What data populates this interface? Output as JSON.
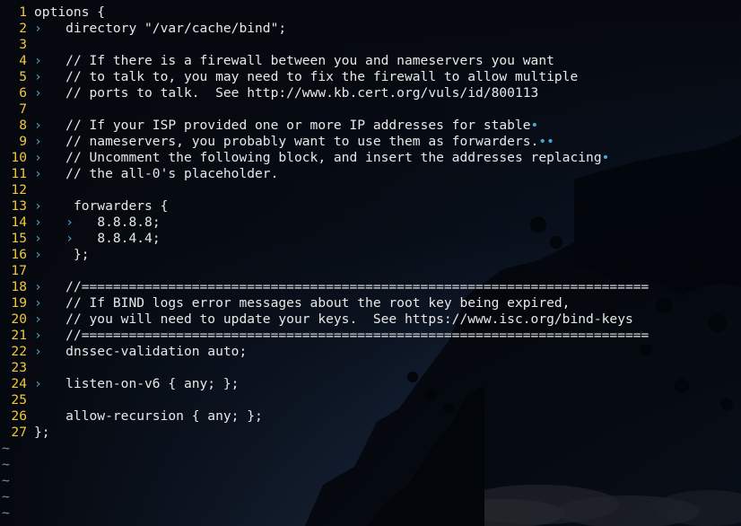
{
  "colors": {
    "line_number": "#f0c83a",
    "tab_marker": "#4aa3d9",
    "text": "#e8e8e8",
    "tilde": "#7a8fa8",
    "background": "#070b13"
  },
  "icons": {
    "tab_marker": "›",
    "trailing_space_marker": "•"
  },
  "editor": {
    "lines": [
      {
        "num": "1",
        "tabs": 0,
        "text": "options {",
        "trail": ""
      },
      {
        "num": "2",
        "tabs": 1,
        "text": "directory \"/var/cache/bind\";",
        "trail": ""
      },
      {
        "num": "3",
        "tabs": 0,
        "text": "",
        "trail": ""
      },
      {
        "num": "4",
        "tabs": 1,
        "text": "// If there is a firewall between you and nameservers you want",
        "trail": ""
      },
      {
        "num": "5",
        "tabs": 1,
        "text": "// to talk to, you may need to fix the firewall to allow multiple",
        "trail": ""
      },
      {
        "num": "6",
        "tabs": 1,
        "text": "// ports to talk.  See http://www.kb.cert.org/vuls/id/800113",
        "trail": ""
      },
      {
        "num": "7",
        "tabs": 0,
        "text": "",
        "trail": ""
      },
      {
        "num": "8",
        "tabs": 1,
        "text": "// If your ISP provided one or more IP addresses for stable",
        "trail": "•"
      },
      {
        "num": "9",
        "tabs": 1,
        "text": "// nameservers, you probably want to use them as forwarders.",
        "trail": "••"
      },
      {
        "num": "10",
        "tabs": 1,
        "text": "// Uncomment the following block, and insert the addresses replacing",
        "trail": "•"
      },
      {
        "num": "11",
        "tabs": 1,
        "text": "// the all-0's placeholder.",
        "trail": ""
      },
      {
        "num": "12",
        "tabs": 0,
        "text": "",
        "trail": ""
      },
      {
        "num": "13",
        "tabs": 1,
        "text": " forwarders {",
        "trail": ""
      },
      {
        "num": "14",
        "tabs": 2,
        "text": "8.8.8.8;",
        "trail": ""
      },
      {
        "num": "15",
        "tabs": 2,
        "text": "8.8.4.4;",
        "trail": ""
      },
      {
        "num": "16",
        "tabs": 1,
        "text": " };",
        "trail": ""
      },
      {
        "num": "17",
        "tabs": 0,
        "text": "",
        "trail": ""
      },
      {
        "num": "18",
        "tabs": 1,
        "text": "//========================================================================",
        "trail": ""
      },
      {
        "num": "19",
        "tabs": 1,
        "text": "// If BIND logs error messages about the root key being expired,",
        "trail": ""
      },
      {
        "num": "20",
        "tabs": 1,
        "text": "// you will need to update your keys.  See https://www.isc.org/bind-keys",
        "trail": ""
      },
      {
        "num": "21",
        "tabs": 1,
        "text": "//========================================================================",
        "trail": ""
      },
      {
        "num": "22",
        "tabs": 1,
        "text": "dnssec-validation auto;",
        "trail": ""
      },
      {
        "num": "23",
        "tabs": 0,
        "text": "",
        "trail": ""
      },
      {
        "num": "24",
        "tabs": 1,
        "text": "listen-on-v6 { any; };",
        "trail": ""
      },
      {
        "num": "25",
        "tabs": 0,
        "text": "",
        "trail": ""
      },
      {
        "num": "26",
        "tabs": 0,
        "text": "    allow-recursion { any; };",
        "trail": ""
      },
      {
        "num": "27",
        "tabs": 0,
        "text": "};",
        "trail": ""
      }
    ],
    "empty_markers": [
      "~",
      "~",
      "~",
      "~",
      "~"
    ]
  }
}
